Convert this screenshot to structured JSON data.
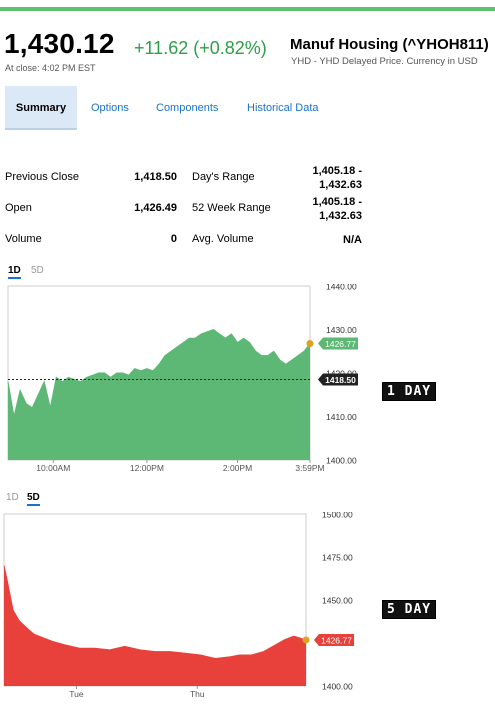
{
  "quote": {
    "price": "1,430.12",
    "change": "+11.62 (+0.82%)",
    "as_of": "At close: 4:02 PM EST",
    "name": "Manuf Housing (^YHOH811)",
    "exchange_note": "YHD - YHD Delayed Price. Currency in USD"
  },
  "tabs": [
    "Summary",
    "Options",
    "Components",
    "Historical Data"
  ],
  "stats": {
    "previous_close": {
      "label": "Previous Close",
      "value": "1,418.50"
    },
    "open": {
      "label": "Open",
      "value": "1,426.49"
    },
    "volume": {
      "label": "Volume",
      "value": "0"
    },
    "days_range": {
      "label": "Day's Range",
      "line1": "1,405.18 -",
      "line2": "1,432.63"
    },
    "week52_range": {
      "label": "52 Week Range",
      "line1": "1,405.18 -",
      "line2": "1,432.63"
    },
    "avg_volume": {
      "label": "Avg. Volume",
      "value": "N/A"
    }
  },
  "chart1": {
    "tabs": {
      "d1": "1D",
      "d5": "5D",
      "active": "1D"
    },
    "badge": "1 DAY",
    "color": "#5cb874",
    "marker_color": "#e0a020"
  },
  "chart2": {
    "tabs": {
      "d1": "1D",
      "d5": "5D",
      "active": "5D"
    },
    "badge": "5 DAY",
    "color": "#e8403a",
    "marker_color": "#e0a020"
  },
  "chart_data": [
    {
      "type": "area",
      "ylim": [
        1400,
        1440
      ],
      "y_ticks": [
        "1440.00",
        "1430.00",
        "1420.00",
        "1410.00",
        "1400.00"
      ],
      "x_ticks": [
        "10:00AM",
        "12:00PM",
        "2:00PM",
        "3:59PM"
      ],
      "last_price_label": "1426.77",
      "prev_close_label": "1418.50",
      "x": [
        0,
        0.02,
        0.04,
        0.06,
        0.08,
        0.1,
        0.12,
        0.14,
        0.16,
        0.18,
        0.2,
        0.22,
        0.24,
        0.26,
        0.28,
        0.3,
        0.32,
        0.34,
        0.36,
        0.38,
        0.4,
        0.42,
        0.44,
        0.46,
        0.48,
        0.5,
        0.52,
        0.54,
        0.56,
        0.58,
        0.6,
        0.62,
        0.64,
        0.66,
        0.68,
        0.7,
        0.72,
        0.74,
        0.76,
        0.78,
        0.8,
        0.82,
        0.84,
        0.86,
        0.88,
        0.9,
        0.92,
        0.94,
        0.96,
        0.98,
        1.0
      ],
      "values": [
        1418,
        1410,
        1416,
        1413,
        1412,
        1415,
        1418,
        1412,
        1419,
        1418,
        1419,
        1418.5,
        1418,
        1419,
        1419.5,
        1420,
        1420,
        1419,
        1420,
        1420,
        1419.5,
        1421,
        1420.5,
        1421,
        1420.5,
        1422,
        1424,
        1425,
        1426,
        1427,
        1428,
        1428,
        1429,
        1429.5,
        1430,
        1429,
        1428,
        1429,
        1427,
        1428,
        1427,
        1425,
        1424,
        1424,
        1425,
        1423,
        1422,
        1423,
        1424,
        1425,
        1426.77
      ]
    },
    {
      "type": "area",
      "ylim": [
        1400,
        1500
      ],
      "y_ticks": [
        "1500.00",
        "1475.00",
        "1450.00",
        "1400.00"
      ],
      "x_ticks": [
        "Tue",
        "Thu"
      ],
      "last_price_label": "1426.77",
      "x": [
        0,
        0.01,
        0.03,
        0.05,
        0.08,
        0.1,
        0.13,
        0.16,
        0.2,
        0.25,
        0.3,
        0.35,
        0.4,
        0.45,
        0.5,
        0.55,
        0.6,
        0.65,
        0.7,
        0.75,
        0.78,
        0.82,
        0.86,
        0.9,
        0.93,
        0.96,
        1.0
      ],
      "values": [
        1470,
        1462,
        1444,
        1438,
        1433,
        1430,
        1428,
        1426,
        1424,
        1422,
        1422,
        1421,
        1423,
        1421,
        1420,
        1420,
        1419,
        1418,
        1416,
        1417,
        1418,
        1418,
        1420,
        1424,
        1427,
        1429,
        1426.77
      ]
    }
  ]
}
